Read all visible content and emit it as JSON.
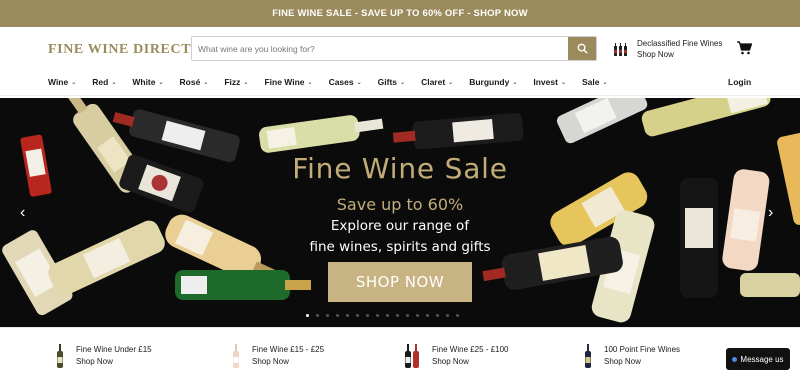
{
  "promo": {
    "text": "FINE WINE SALE - SAVE UP TO 60% OFF - SHOP NOW"
  },
  "header": {
    "logo": "FINE WINE DIRECT",
    "search_placeholder": "What wine are you looking for?",
    "declassified_title": "Declassified Fine Wines",
    "declassified_link": "Shop Now"
  },
  "nav": {
    "items": [
      "Wine",
      "Red",
      "White",
      "Rosé",
      "Fizz",
      "Fine Wine",
      "Cases",
      "Gifts",
      "Claret",
      "Burgundy",
      "Invest",
      "Sale"
    ],
    "login": "Login"
  },
  "hero": {
    "title": "Fine Wine Sale",
    "subtitle": "Save up to 60%",
    "line1": "Explore our range of",
    "line2": "fine wines, spirits and gifts",
    "button": "SHOP NOW",
    "slide_count": 16,
    "active_slide": 1
  },
  "categories": [
    {
      "title": "Fine Wine Under £15",
      "link": "Shop Now"
    },
    {
      "title": "Fine Wine £15 - £25",
      "link": "Shop Now"
    },
    {
      "title": "Fine Wine £25 - £100",
      "link": "Shop Now"
    },
    {
      "title": "100 Point Fine Wines",
      "link": "Shop Now"
    }
  ],
  "chat": {
    "label": "Message us"
  },
  "colors": {
    "brand": "#9b8a5c",
    "hero_gold": "#c2ad78",
    "button_gold": "#c8b383"
  }
}
